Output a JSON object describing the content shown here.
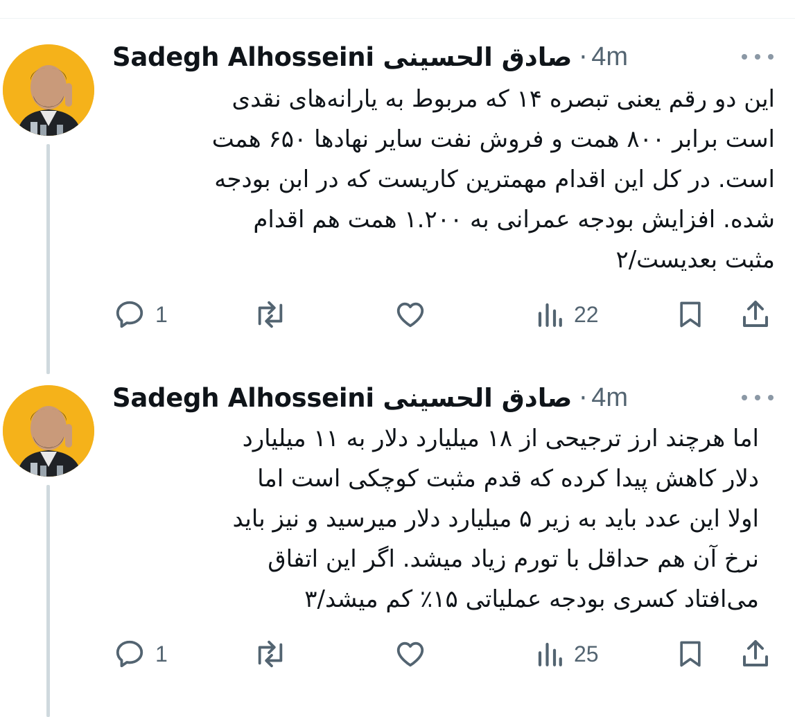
{
  "tweets": [
    {
      "author": {
        "name": "Sadegh Alhosseini صادق الحسینی",
        "separator": "·",
        "time": "4m"
      },
      "lines": [
        "این دو رقم یعنی تبصره ۱۴ که مربوط به یارانه‌های نقدی",
        "است برابر ۸۰۰ همت و فروش نفت سایر نهادها ۶۵۰ همت",
        "است. در کل این اقدام مهمترین کاریست که در ابن بودجه",
        "شده. افزایش بودجه عمرانی به ۱.۲۰۰ همت هم اقدام",
        "مثبت بعدیست/۲"
      ],
      "actions": {
        "replies": "1",
        "reposts": "",
        "likes": "",
        "views": "22"
      }
    },
    {
      "author": {
        "name": "Sadegh Alhosseini صادق الحسینی",
        "separator": "·",
        "time": "4m"
      },
      "lines": [
        "اما هرچند ارز ترجیحی از ۱۸ میلیارد دلار به ۱۱ میلیارد",
        "دلار کاهش پیدا کرده که قدم مثبت کوچکی است اما",
        "اولا این عدد باید به زیر ۵ میلیارد دلار میرسید و نیز باید",
        "نرخ آن هم حداقل با تورم زیاد میشد. اگر این اتفاق",
        "می‌افتاد کسری بودجه عملیاتی ۱۵٪ کم میشد/۳"
      ],
      "actions": {
        "replies": "1",
        "reposts": "",
        "likes": "",
        "views": "25"
      }
    }
  ],
  "icons": {
    "reply": "speech-bubble-icon",
    "repost": "repost-arrows-icon",
    "like": "heart-icon",
    "views": "bar-chart-icon",
    "bookmark": "bookmark-icon",
    "share": "share-upload-icon",
    "more": "ellipsis-icon"
  },
  "colors": {
    "text": "#0f1419",
    "secondary": "#536471",
    "thread_line": "#cfd9de",
    "avatar_bg": "#f5b21a"
  }
}
